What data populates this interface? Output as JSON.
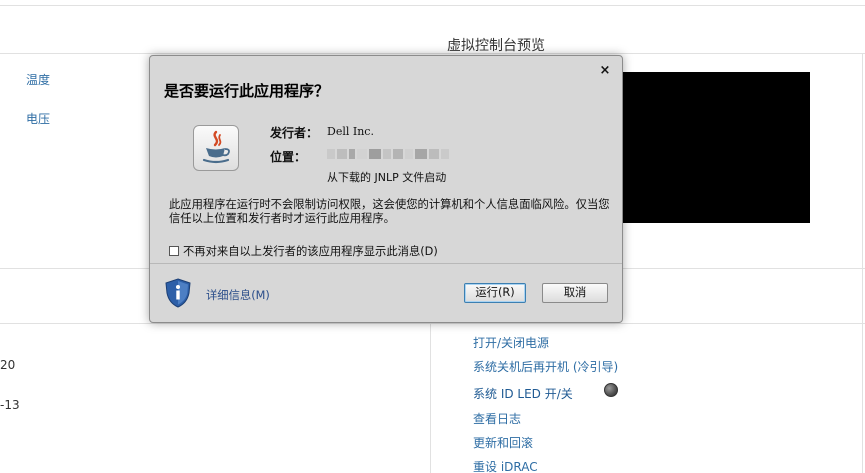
{
  "background": {
    "sensor_links": [
      "温度",
      "电压"
    ],
    "preview_title": "虚拟控制台预览",
    "left_values": [
      "20",
      "-13"
    ],
    "actions": [
      "打开/关闭电源",
      "系统关机后再开机 (冷引导)",
      "系统 ID LED 开/关",
      "查看日志",
      "更新和回滚",
      "重设 iDRAC"
    ]
  },
  "dialog": {
    "title": "是否要运行此应用程序？",
    "close_symbol": "×",
    "publisher_label": "发行者：",
    "publisher_value": "Dell Inc.",
    "location_label": "位置：",
    "location_note": "从下载的 JNLP 文件启动",
    "warning": "此应用程序在运行时不会限制访问权限，这会使您的计算机和个人信息面临风险。仅当您信任以上位置和发行者时才运行此应用程序。",
    "checkbox_label": "不再对来自以上发行者的该应用程序显示此消息(D)",
    "details_link": "详细信息(M)",
    "run_button": "运行(R)",
    "cancel_button": "取消"
  },
  "icons": [
    "java-icon",
    "shield-info-icon",
    "close-icon",
    "led-indicator-icon"
  ]
}
